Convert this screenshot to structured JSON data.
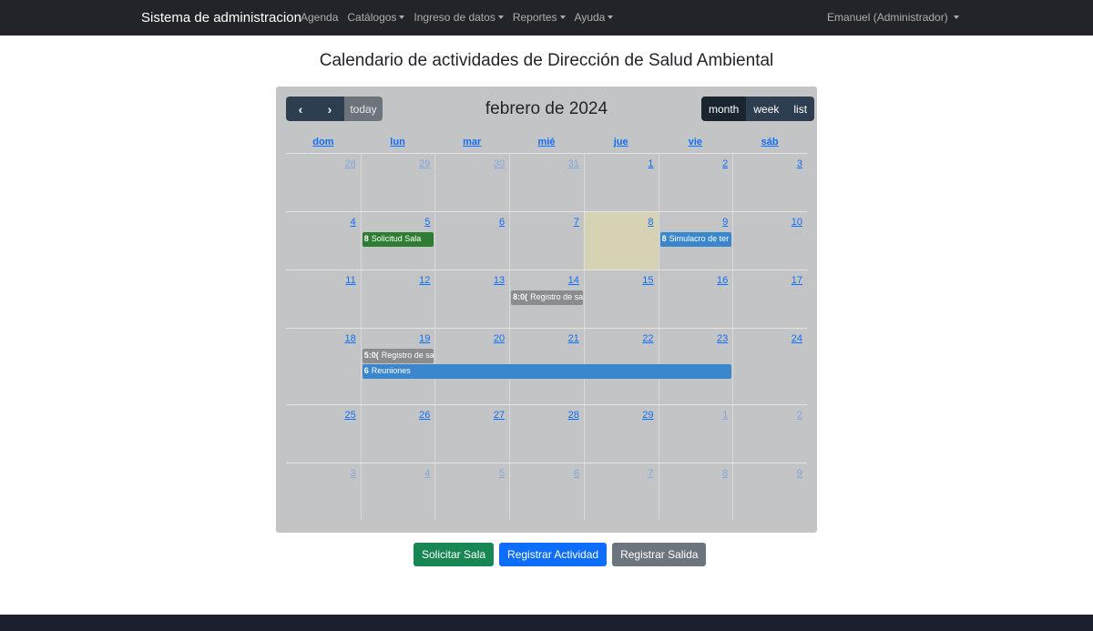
{
  "navbar": {
    "brand": "Sistema de administracion",
    "items": [
      {
        "label": "Agenda",
        "dropdown": false
      },
      {
        "label": "Catálogos",
        "dropdown": true
      },
      {
        "label": "Ingreso de datos",
        "dropdown": true
      },
      {
        "label": "Reportes",
        "dropdown": true
      },
      {
        "label": "Ayuda",
        "dropdown": true
      }
    ],
    "user": "Emanuel (Administrador)"
  },
  "page": {
    "title": "Calendario de actividades de Dirección de Salud Ambiental"
  },
  "calendar": {
    "month_title": "febrero de 2024",
    "prev_icon": "chevron-left-icon",
    "next_icon": "chevron-right-icon",
    "prev_glyph": "‹",
    "next_glyph": "›",
    "today_label": "today",
    "views": [
      "month",
      "week",
      "list"
    ],
    "active_view": "month",
    "dow": [
      "dom",
      "lun",
      "mar",
      "mié",
      "jue",
      "vie",
      "sáb"
    ],
    "weeks": [
      [
        "28",
        "29",
        "30",
        "31",
        "1",
        "2",
        "3"
      ],
      [
        "4",
        "5",
        "6",
        "7",
        "8",
        "9",
        "10"
      ],
      [
        "11",
        "12",
        "13",
        "14",
        "15",
        "16",
        "17"
      ],
      [
        "18",
        "19",
        "20",
        "21",
        "22",
        "23",
        "24"
      ],
      [
        "25",
        "26",
        "27",
        "28",
        "29",
        "1",
        "2"
      ],
      [
        "3",
        "4",
        "5",
        "6",
        "7",
        "8",
        "9"
      ]
    ],
    "events": [
      {
        "time": "8",
        "title": "Solicitud Sala",
        "color": "#2e7d32"
      },
      {
        "time": "8",
        "title": "Simulacro de ter",
        "color": "#3a87cd"
      },
      {
        "time": "8:0(",
        "title": "Registro de sa",
        "color": "#8a8c8e"
      },
      {
        "time": "5:0(",
        "title": "Registro de sa",
        "color": "#8a8c8e"
      },
      {
        "time": "6",
        "title": "Reuniones",
        "color": "#3a87cd"
      }
    ]
  },
  "actions": {
    "request_room": "Solicitar Sala",
    "register_activity": "Registrar Actividad",
    "register_exit": "Registrar Salida"
  }
}
